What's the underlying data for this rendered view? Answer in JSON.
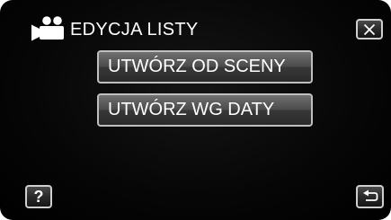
{
  "header": {
    "icon": "video-camera-icon",
    "title": "EDYCJA LISTY"
  },
  "menu": {
    "items": [
      {
        "label": "UTWÓRZ OD SCENY"
      },
      {
        "label": "UTWÓRZ WG DATY"
      }
    ]
  },
  "controls": {
    "close_icon": "close-icon",
    "help_label": "?",
    "back_icon": "back-arrow-icon"
  },
  "colors": {
    "background": "#000000",
    "button_fill": "#4c4c4c",
    "button_border": "#bfbfbf",
    "text": "#ffffff"
  }
}
